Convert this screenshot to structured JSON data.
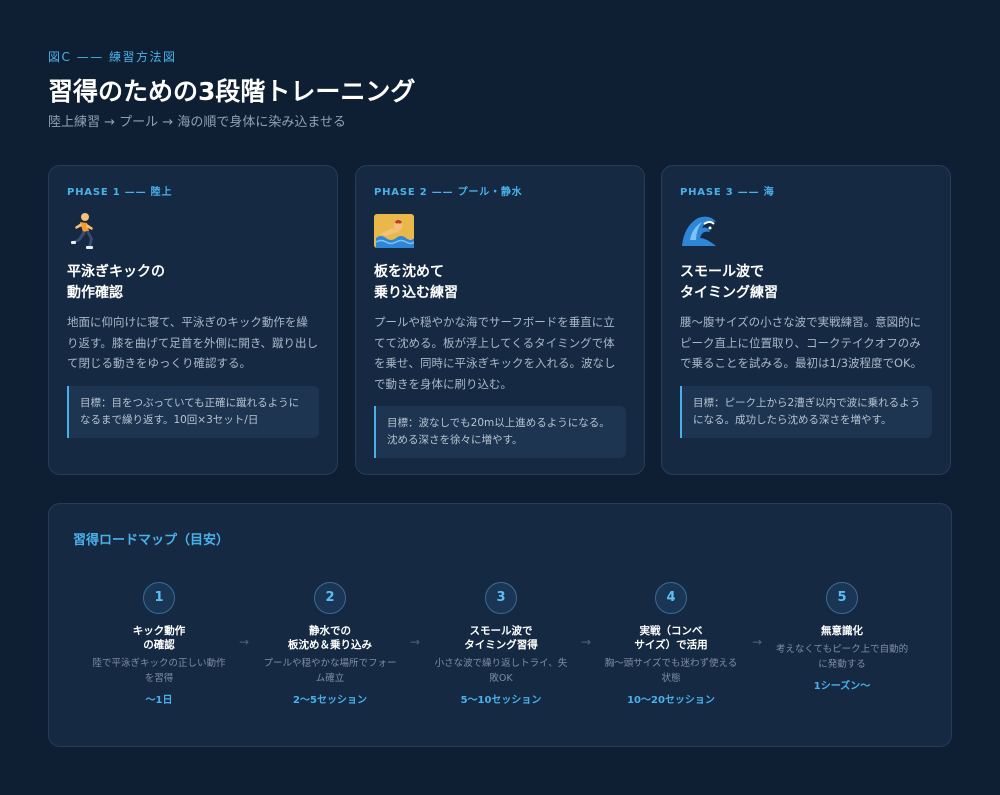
{
  "figure_label": "図C —— 練習方法図",
  "title": "習得のための3段階トレーニング",
  "subtitle": "陸上練習 → プール → 海の順で身体に染み込ませる",
  "phases": [
    {
      "label": "PHASE 1 —— 陸上",
      "icon": "running-person-icon",
      "title": "平泳ぎキックの\n動作確認",
      "description": "地面に仰向けに寝て、平泳ぎのキック動作を繰り返す。膝を曲げて足首を外側に開き、蹴り出して閉じる動きをゆっくり確認する。",
      "goal": "目標：目をつぶっていても正確に蹴れるようになるまで繰り返す。10回×3セット/日"
    },
    {
      "label": "PHASE 2 —— プール・静水",
      "icon": "swimmer-icon",
      "title": "板を沈めて\n乗り込む練習",
      "description": "プールや穏やかな海でサーフボードを垂直に立てて沈める。板が浮上してくるタイミングで体を乗せ、同時に平泳ぎキックを入れる。波なしで動きを身体に刷り込む。",
      "goal": "目標：波なしでも20m以上進めるようになる。沈める深さを徐々に増やす。"
    },
    {
      "label": "PHASE 3 —— 海",
      "icon": "wave-icon",
      "title": "スモール波で\nタイミング練習",
      "description": "腰〜腹サイズの小さな波で実戦練習。意図的にピーク直上に位置取り、コークテイクオフのみで乗ることを試みる。最初は1/3波程度でOK。",
      "goal": "目標：ピーク上から2漕ぎ以内で波に乗れるようになる。成功したら沈める深さを増やす。"
    }
  ],
  "roadmap": {
    "title": "習得ロードマップ（目安）",
    "steps": [
      {
        "number": "1",
        "title": "キック動作\nの確認",
        "description": "陸で平泳ぎキックの正しい動作を習得",
        "duration": "〜1日"
      },
      {
        "number": "2",
        "title": "静水での\n板沈め＆乗り込み",
        "description": "プールや穏やかな場所でフォーム確立",
        "duration": "2〜5セッション"
      },
      {
        "number": "3",
        "title": "スモール波で\nタイミング習得",
        "description": "小さな波で繰り返しトライ、失敗OK",
        "duration": "5〜10セッション"
      },
      {
        "number": "4",
        "title": "実戦（コンベ\nサイズ）で活用",
        "description": "胸〜頭サイズでも迷わず使える状態",
        "duration": "10〜20セッション"
      },
      {
        "number": "5",
        "title": "無意識化",
        "description": "考えなくてもピーク上で自動的に発動する",
        "duration": "1シーズン〜"
      }
    ],
    "arrow_glyph": "→"
  },
  "colors": {
    "background": "#0f1f33",
    "card": "#152a42",
    "accent": "#4ab0ea"
  }
}
